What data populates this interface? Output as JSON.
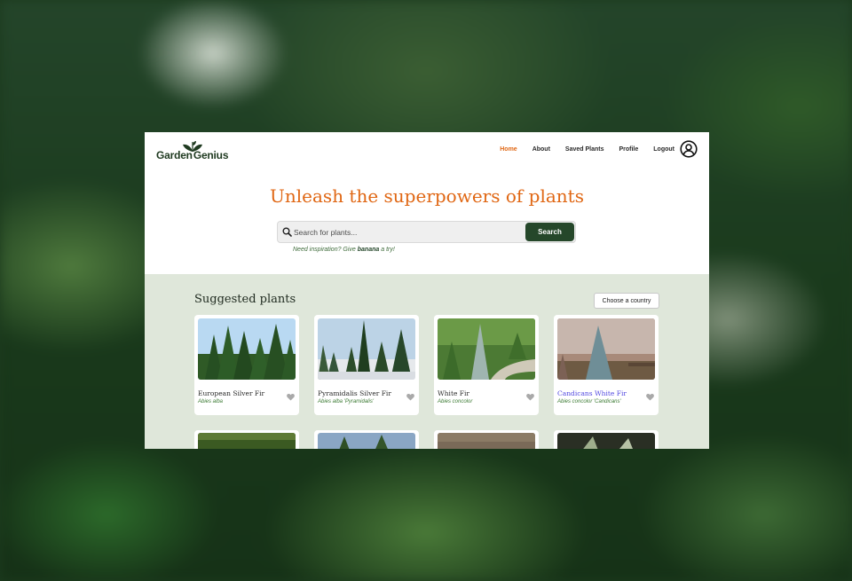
{
  "brand": {
    "name_part1": "Garden",
    "name_part2": "Genius"
  },
  "nav": {
    "items": [
      {
        "label": "Home",
        "active": true
      },
      {
        "label": "About",
        "active": false
      },
      {
        "label": "Saved Plants",
        "active": false
      },
      {
        "label": "Profile",
        "active": false
      },
      {
        "label": "Logout",
        "active": false
      }
    ]
  },
  "hero": {
    "title": "Unleash the superpowers of plants"
  },
  "search": {
    "placeholder": "Search for plants...",
    "button_label": "Search",
    "hint_prefix": "Need inspiration? Give ",
    "hint_keyword": "banana",
    "hint_suffix": " a try!"
  },
  "suggested": {
    "title": "Suggested plants",
    "country_button": "Choose a country",
    "cards": [
      {
        "name": "European Silver Fir",
        "scientific": "Abies alba"
      },
      {
        "name": "Pyramidalis Silver Fir",
        "scientific": "Abies alba 'Pyramidalis'"
      },
      {
        "name": "White Fir",
        "scientific": "Abies concolor"
      },
      {
        "name": "Candicans White Fir",
        "scientific": "Abies concolor 'Candicans'"
      }
    ]
  },
  "colors": {
    "accent": "#e06714",
    "brand_green": "#25472a",
    "section_bg": "#dfe7da",
    "link": "#5148e0"
  },
  "icons": [
    "leaf-logo-icon",
    "user-circle-icon",
    "search-icon",
    "heart-icon"
  ]
}
